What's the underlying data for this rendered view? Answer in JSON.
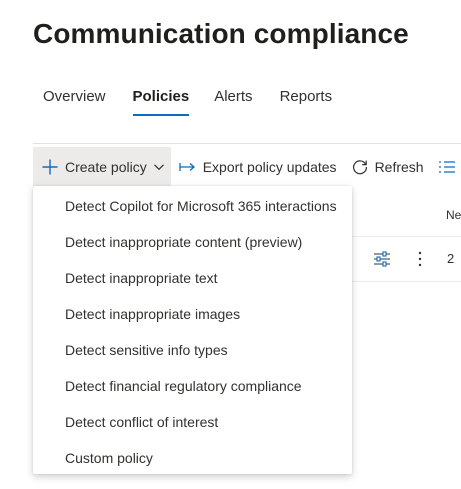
{
  "page": {
    "title": "Communication compliance"
  },
  "tabs": [
    {
      "label": "Overview",
      "selected": false
    },
    {
      "label": "Policies",
      "selected": true
    },
    {
      "label": "Alerts",
      "selected": false
    },
    {
      "label": "Reports",
      "selected": false
    }
  ],
  "toolbar": {
    "create_policy_label": "Create policy",
    "export_label": "Export policy updates",
    "refresh_label": "Refresh",
    "icons": {
      "create": "plus-icon",
      "create_caret": "chevron-down-icon",
      "export": "export-arrow-icon",
      "refresh": "refresh-icon",
      "more": "list-icon"
    }
  },
  "grid": {
    "header_partial": "Ne",
    "row": {
      "value": "2",
      "icons": [
        "settings-sliders-icon",
        "more-vertical-icon"
      ]
    }
  },
  "create_menu": {
    "items": [
      "Detect Copilot for Microsoft 365 interactions",
      "Detect inappropriate content (preview)",
      "Detect inappropriate text",
      "Detect inappropriate images",
      "Detect sensitive info types",
      "Detect financial regulatory compliance",
      "Detect conflict of interest",
      "Custom policy"
    ]
  },
  "colors": {
    "accent": "#0f6cbd",
    "text": "#323130",
    "title": "#201f1e",
    "active_button_bg": "#edebe9"
  }
}
